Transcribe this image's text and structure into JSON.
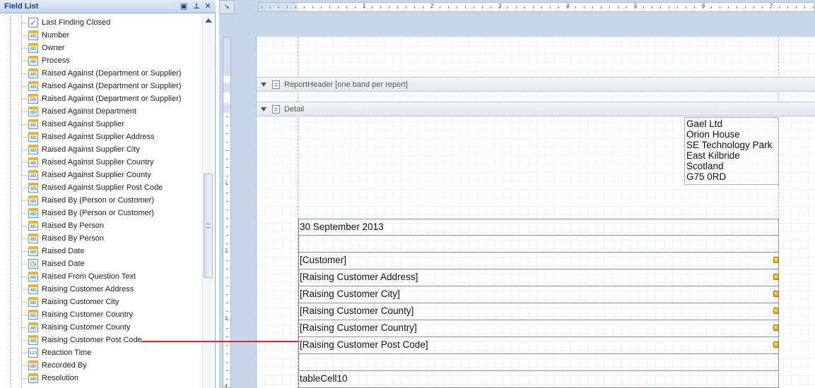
{
  "panel": {
    "title": "Field List",
    "buttons": {
      "pin": "▣",
      "autohide": "⊥",
      "close": "✕"
    }
  },
  "fields": [
    {
      "label": "Last Finding Closed",
      "type": "check"
    },
    {
      "label": "Number",
      "type": "ab"
    },
    {
      "label": "Owner",
      "type": "ab"
    },
    {
      "label": "Process",
      "type": "ab"
    },
    {
      "label": "Raised Against (Department or Supplier)",
      "type": "ab"
    },
    {
      "label": "Raised Against (Department or Supplier)",
      "type": "ab"
    },
    {
      "label": "Raised Against (Department or Supplier)",
      "type": "ab"
    },
    {
      "label": "Raised Against Department",
      "type": "ab"
    },
    {
      "label": "Raised Against Supplier",
      "type": "ab"
    },
    {
      "label": "Raised Against Supplier Address",
      "type": "ab"
    },
    {
      "label": "Raised Against Supplier City",
      "type": "ab"
    },
    {
      "label": "Raised Against Supplier Country",
      "type": "ab"
    },
    {
      "label": "Raised Against Supplier County",
      "type": "ab"
    },
    {
      "label": "Raised Against Supplier Post Code",
      "type": "ab"
    },
    {
      "label": "Raised By (Person or Customer)",
      "type": "ab"
    },
    {
      "label": "Raised By (Person or Customer)",
      "type": "ab"
    },
    {
      "label": "Raised By Person",
      "type": "ab"
    },
    {
      "label": "Raised By Person",
      "type": "ab"
    },
    {
      "label": "Raised Date",
      "type": "ab"
    },
    {
      "label": "Raised Date",
      "type": "date"
    },
    {
      "label": "Raised From Question Text",
      "type": "ab"
    },
    {
      "label": "Raising Customer Address",
      "type": "ab"
    },
    {
      "label": "Raising Customer City",
      "type": "ab"
    },
    {
      "label": "Raising Customer Country",
      "type": "ab"
    },
    {
      "label": "Raising Customer County",
      "type": "ab"
    },
    {
      "label": "Raising Customer Post Code",
      "type": "ab"
    },
    {
      "label": "Reaction Time",
      "type": "num"
    },
    {
      "label": "Recorded By",
      "type": "ab"
    },
    {
      "label": "Resolution",
      "type": "ab"
    }
  ],
  "icons": {
    "ab": "ab",
    "check": "✓",
    "date": "◷",
    "num": "123"
  },
  "designer": {
    "corner_icon": "↘",
    "ruler_numbers": [
      "1",
      "2",
      "3",
      "4",
      "5",
      "6",
      "7"
    ],
    "vruler_numbers": [
      "1",
      "2",
      "3",
      "4"
    ],
    "bands": {
      "report_header": "ReportHeader [one band per report]",
      "detail": "Detail"
    },
    "address": [
      "Gael Ltd",
      "Orion House",
      "SE Technology Park",
      "East Kilbride",
      "Scotland",
      "G75 0RD"
    ],
    "cells": [
      {
        "text": "30 September 2013",
        "tag": false
      },
      {
        "text": "",
        "tag": false
      },
      {
        "text": "[Customer]",
        "tag": true
      },
      {
        "text": "[Raising Customer Address]",
        "tag": true
      },
      {
        "text": "[Raising Customer City]",
        "tag": true
      },
      {
        "text": "[Raising Customer County]",
        "tag": true
      },
      {
        "text": "[Raising Customer Country]",
        "tag": true
      },
      {
        "text": "[Raising Customer Post Code]",
        "tag": true
      },
      {
        "text": "",
        "tag": false
      },
      {
        "text": "tableCell10",
        "tag": false
      }
    ]
  },
  "colors": {
    "connector": "#e3262b",
    "panel_title": "#15428b",
    "designer_bg": "#c9d7ea"
  }
}
